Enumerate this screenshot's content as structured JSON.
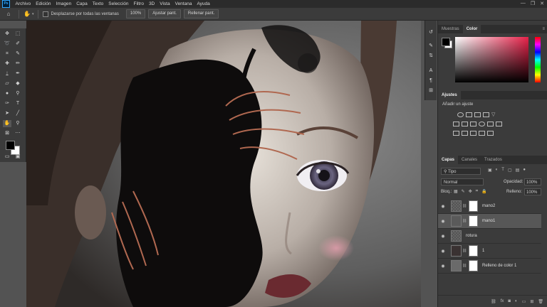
{
  "app_icon": "Ps",
  "menu": [
    "Archivo",
    "Edición",
    "Imagen",
    "Capa",
    "Texto",
    "Selección",
    "Filtro",
    "3D",
    "Vista",
    "Ventana",
    "Ayuda"
  ],
  "options": {
    "scroll_all_label": "Desplazarse por todas las ventanas",
    "zoom_label": "100%",
    "fit_label": "Ajustar pant.",
    "fill_label": "Rellenar pant."
  },
  "panels": {
    "swatches_tab": "Muestras",
    "color_tab": "Color",
    "adjustments_title": "Ajustes",
    "add_adjustment": "Añadir un ajuste",
    "layers_tab": "Capas",
    "channels_tab": "Canales",
    "paths_tab": "Trazados"
  },
  "layers_panel": {
    "filter_kind": "Tipo",
    "blend_mode": "Normal",
    "opacity_label": "Opacidad:",
    "opacity_value": "100%",
    "lock_label": "Bloq.:",
    "fill_label": "Relleno:",
    "fill_value": "100%",
    "layers": [
      {
        "name": "mano2",
        "selected": false
      },
      {
        "name": "mano1",
        "selected": true
      },
      {
        "name": "rotura",
        "selected": false
      },
      {
        "name": "1",
        "selected": false
      },
      {
        "name": "Relleno de color 1",
        "selected": false
      }
    ]
  },
  "colors": {
    "accent": "#31a8ff",
    "panel": "#3b3b3b",
    "selected_layer": "#575757"
  }
}
